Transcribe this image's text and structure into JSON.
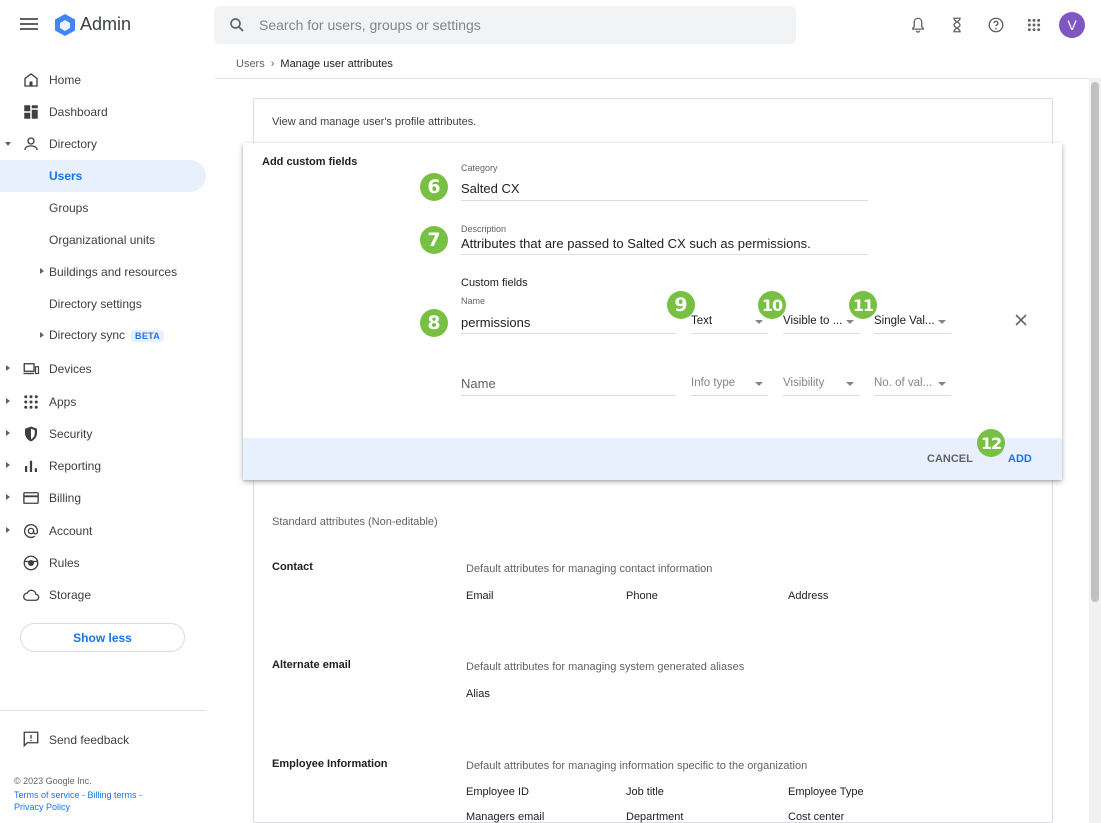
{
  "app": {
    "title": "Admin"
  },
  "search": {
    "placeholder": "Search for users, groups or settings"
  },
  "user": {
    "initial": "V"
  },
  "sidebar": {
    "items": [
      {
        "label": "Home"
      },
      {
        "label": "Dashboard"
      },
      {
        "label": "Directory"
      },
      {
        "label": "Users"
      },
      {
        "label": "Groups"
      },
      {
        "label": "Organizational units"
      },
      {
        "label": "Buildings and resources"
      },
      {
        "label": "Directory settings"
      },
      {
        "label": "Directory sync",
        "badge": "BETA"
      },
      {
        "label": "Devices"
      },
      {
        "label": "Apps"
      },
      {
        "label": "Security"
      },
      {
        "label": "Reporting"
      },
      {
        "label": "Billing"
      },
      {
        "label": "Account"
      },
      {
        "label": "Rules"
      },
      {
        "label": "Storage"
      }
    ],
    "show_less": "Show less",
    "feedback": "Send feedback",
    "copyright": "© 2023 Google Inc.",
    "legal": {
      "terms": "Terms of service",
      "billing": "Billing terms",
      "privacy": "Privacy Policy",
      "sep": " - "
    }
  },
  "breadcrumb": {
    "parent": "Users",
    "sep": "›",
    "current": "Manage user attributes"
  },
  "intro": "View and manage user's profile attributes.",
  "dialog": {
    "title": "Add custom fields",
    "category": {
      "label": "Category",
      "value": "Salted CX"
    },
    "description": {
      "label": "Description",
      "value": "Attributes that are passed to Salted CX such as permissions."
    },
    "custom_fields_label": "Custom fields",
    "row1": {
      "name_label": "Name",
      "name": "permissions",
      "info_type": "Text",
      "visibility": "Visible to ...",
      "values": "Single Val..."
    },
    "row2": {
      "name_placeholder": "Name",
      "info_type": "Info type",
      "visibility": "Visibility",
      "values": "No. of val..."
    },
    "cancel": "CANCEL",
    "add": "ADD"
  },
  "badges": [
    "6",
    "7",
    "8",
    "9",
    "10",
    "11",
    "12"
  ],
  "standard": {
    "title": "Standard attributes (Non-editable)",
    "groups": [
      {
        "title": "Contact",
        "desc": "Default attributes for managing contact information",
        "attrs": [
          "Email",
          "Phone",
          "Address"
        ]
      },
      {
        "title": "Alternate email",
        "desc": "Default attributes for managing system generated aliases",
        "attrs": [
          "Alias"
        ]
      },
      {
        "title": "Employee Information",
        "desc": "Default attributes for managing information specific to the organization",
        "attrs": [
          "Employee ID",
          "Job title",
          "Employee Type",
          "Managers email",
          "Department",
          "Cost center"
        ]
      }
    ]
  },
  "colors": {
    "accent": "#1a73e8",
    "badge": "#77c043",
    "avatar": "#7e57c2",
    "footer": "#e8f0fe"
  }
}
